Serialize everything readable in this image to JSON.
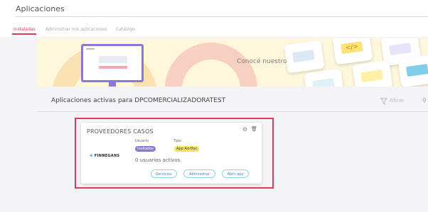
{
  "header": {
    "title": "Aplicaciones",
    "tabs": [
      {
        "label": "Instaladas"
      },
      {
        "label": "Administrar mis aplicaciones"
      },
      {
        "label": "Catálogo"
      }
    ]
  },
  "banner": {
    "text": "Conocé nuestro catalogo"
  },
  "section": {
    "title": "Aplicaciones activas para DPCOMERCIALIZADORATEST",
    "filter_label": "Filtrar"
  },
  "app_card": {
    "title": "PROVEEDORES CASOS",
    "logo_text": "FINNEGANS",
    "usuario_label": "Usuario",
    "usuario_value": "Invitados",
    "tipo_label": "Tipo",
    "tipo_value": "App Ad-Hoc",
    "users_text": "0 usuarios activos",
    "buttons": [
      {
        "label": "Servicios"
      },
      {
        "label": "Administrar"
      },
      {
        "label": "Abrir app"
      }
    ]
  },
  "colors": {
    "accent": "#e03a57",
    "highlight": "#e5375a",
    "badge_purple": "#8a7ad6",
    "badge_yellow": "#f6e25c",
    "pill_border": "#8fd3e8"
  }
}
